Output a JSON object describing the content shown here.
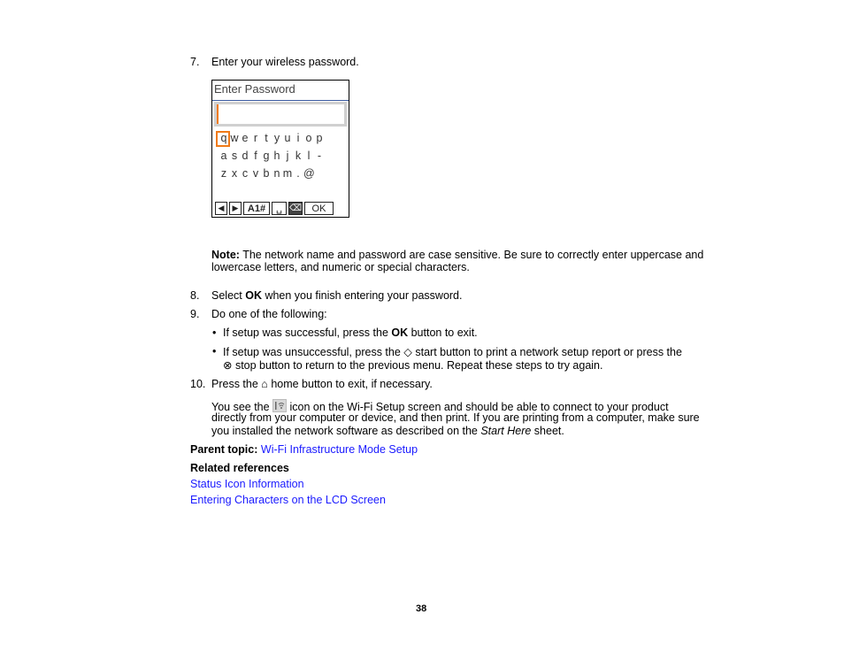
{
  "step7": {
    "number": "7.",
    "text": "Enter your wireless password."
  },
  "lcd": {
    "title": "Enter Password",
    "input_value": "",
    "selected_key": "q",
    "rows": [
      [
        "q",
        "w",
        "e",
        "r",
        "t",
        "y",
        "u",
        "i",
        "o",
        "p"
      ],
      [
        "a",
        "s",
        "d",
        "f",
        "g",
        "h",
        "j",
        "k",
        "l",
        "-"
      ],
      [
        "z",
        "x",
        "c",
        "v",
        "b",
        "n",
        "m",
        ".",
        "@"
      ]
    ],
    "bottom_keys": {
      "left": "◀",
      "right": "▶",
      "mode": "A1#",
      "space": "␣",
      "backspace": "⌫",
      "ok": "OK"
    }
  },
  "note": {
    "label": "Note:",
    "line1": " The network name and password are case sensitive. Be sure to correctly enter uppercase and",
    "line2": "lowercase letters, and numeric or special characters."
  },
  "step8": {
    "number": "8.",
    "pre": "Select ",
    "bold": "OK",
    "post": " when you finish entering your password."
  },
  "step9": {
    "number": "9.",
    "text": "Do one of the following:",
    "bullets": [
      {
        "pre": "If setup was successful, press the ",
        "bold": "OK",
        "post": " button to exit."
      },
      {
        "line1_pre": "If setup was unsuccessful, press the ",
        "start_icon": "◇",
        "line1_post": " start button to print a network setup report or press the",
        "stop_icon": "⊗",
        "line2": " stop button to return to the previous menu. Repeat these steps to try again."
      }
    ]
  },
  "step10": {
    "number": "10.",
    "pre": "Press the ",
    "home_icon": "⌂",
    "post": " home button to exit, if necessary.",
    "para_pre": "You see the ",
    "para_line1_post": " icon on the Wi-Fi Setup screen and should be able to connect to your product",
    "para_line2": "directly from your computer or device, and then print. If you are printing from a computer, make sure",
    "para_line3_pre": "you installed the network software as described on the ",
    "para_line3_italic": "Start Here",
    "para_line3_post": " sheet."
  },
  "parent_topic": {
    "label": "Parent topic:",
    "link": "Wi-Fi Infrastructure Mode Setup"
  },
  "related": {
    "heading": "Related references",
    "links": [
      "Status Icon Information",
      "Entering Characters on the LCD Screen"
    ]
  },
  "page_number": "38",
  "colors": {
    "link": "#1a1aff",
    "lcd_highlight": "#f07a18"
  }
}
